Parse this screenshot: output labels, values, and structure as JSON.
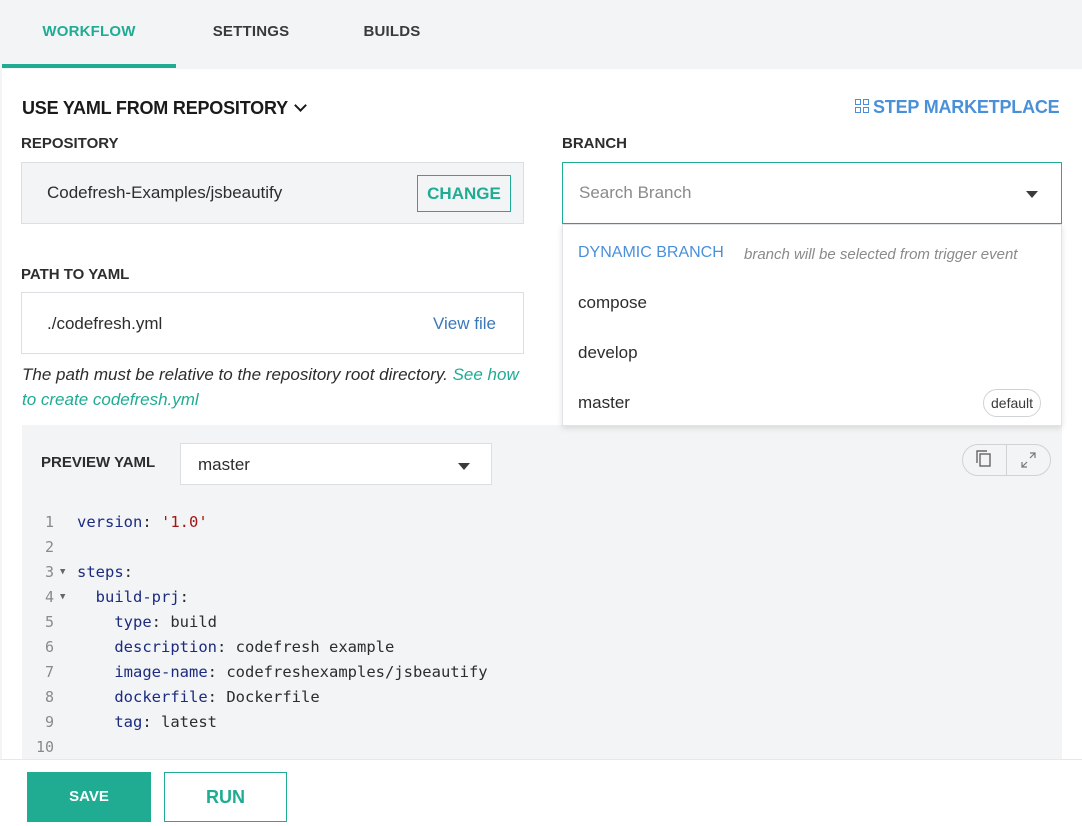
{
  "tabs": [
    {
      "label": "WORKFLOW",
      "active": true
    },
    {
      "label": "SETTINGS",
      "active": false
    },
    {
      "label": "BUILDS",
      "active": false
    }
  ],
  "yaml_source": {
    "label": "USE YAML FROM REPOSITORY",
    "icon": "chevron-down-icon"
  },
  "marketplace": {
    "label": "STEP MARKETPLACE",
    "icon": "grid-icon"
  },
  "repository": {
    "label": "REPOSITORY",
    "value": "Codefresh-Examples/jsbeautify",
    "change_label": "CHANGE"
  },
  "branch": {
    "label": "BRANCH",
    "placeholder": "Search Branch",
    "dropdown": {
      "dynamic": {
        "label": "DYNAMIC BRANCH",
        "hint": "branch will be selected from trigger event"
      },
      "items": [
        {
          "name": "compose",
          "badge": ""
        },
        {
          "name": "develop",
          "badge": ""
        },
        {
          "name": "master",
          "badge": "default"
        }
      ]
    }
  },
  "path": {
    "label": "PATH TO YAML",
    "value": "./codefresh.yml",
    "view_file_label": "View file",
    "help_text": "The path must be relative to the repository root directory.",
    "help_link": "See how to create codefresh.yml"
  },
  "preview": {
    "label": "PREVIEW YAML",
    "selected_branch": "master",
    "icons": [
      "copy-icon",
      "expand-icon"
    ],
    "code_lines": [
      {
        "n": "1",
        "indent": "",
        "key": "version",
        "value": "'1.0'",
        "string": true,
        "fold": false
      },
      {
        "n": "2",
        "indent": "",
        "key": "",
        "value": "",
        "string": false,
        "fold": false
      },
      {
        "n": "3",
        "indent": "",
        "key": "steps",
        "value": "",
        "string": false,
        "fold": true
      },
      {
        "n": "4",
        "indent": "  ",
        "key": "build-prj",
        "value": "",
        "string": false,
        "fold": true
      },
      {
        "n": "5",
        "indent": "    ",
        "key": "type",
        "value": "build",
        "string": false,
        "fold": false
      },
      {
        "n": "6",
        "indent": "    ",
        "key": "description",
        "value": "codefresh example",
        "string": false,
        "fold": false
      },
      {
        "n": "7",
        "indent": "    ",
        "key": "image-name",
        "value": "codefreshexamples/jsbeautify",
        "string": false,
        "fold": false
      },
      {
        "n": "8",
        "indent": "    ",
        "key": "dockerfile",
        "value": "Dockerfile",
        "string": false,
        "fold": false
      },
      {
        "n": "9",
        "indent": "    ",
        "key": "tag",
        "value": "latest",
        "string": false,
        "fold": false
      },
      {
        "n": "10",
        "indent": "",
        "key": "",
        "value": "",
        "string": false,
        "fold": false
      }
    ]
  },
  "footer": {
    "save_label": "SAVE",
    "run_label": "RUN"
  },
  "colors": {
    "accent": "#1fac93",
    "link": "#4a90d9",
    "yaml_key": "#1c2b7f",
    "yaml_string": "#a31515"
  }
}
